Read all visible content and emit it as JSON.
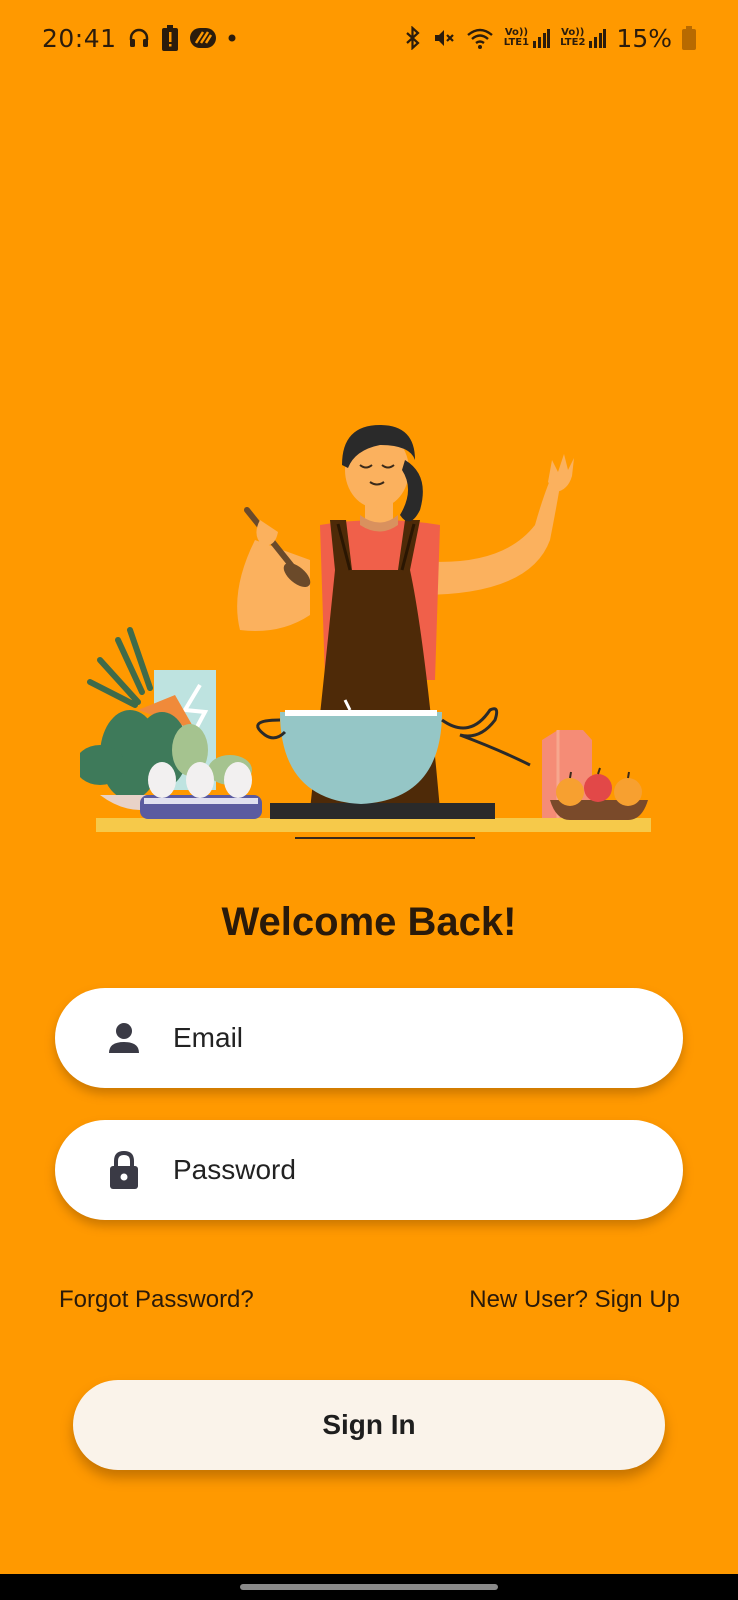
{
  "status_bar": {
    "time": "20:41",
    "left_icons": [
      "headphones-icon",
      "battery-alert-icon",
      "app-notification-icon",
      "dot-icon"
    ],
    "right_icons": [
      "bluetooth-icon",
      "mute-icon",
      "wifi-icon",
      "signal-lte1-icon",
      "signal-lte2-icon",
      "battery-icon"
    ],
    "lte1_label": "LTE1",
    "lte2_label": "LTE2",
    "volte_label": "Vo))",
    "battery_percent": "15%"
  },
  "illustration": {
    "subject": "woman-cooking-illustration"
  },
  "login": {
    "title": "Welcome Back!",
    "email_placeholder": "Email",
    "email_value": "",
    "password_placeholder": "Password",
    "password_value": "",
    "forgot_password_label": "Forgot Password?",
    "signup_label": "New User? Sign Up",
    "signin_label": "Sign In"
  },
  "colors": {
    "background": "#FF9900",
    "field_background": "#FFFFFF",
    "button_background": "#FAF3EA",
    "text": "#2A1A0A"
  }
}
